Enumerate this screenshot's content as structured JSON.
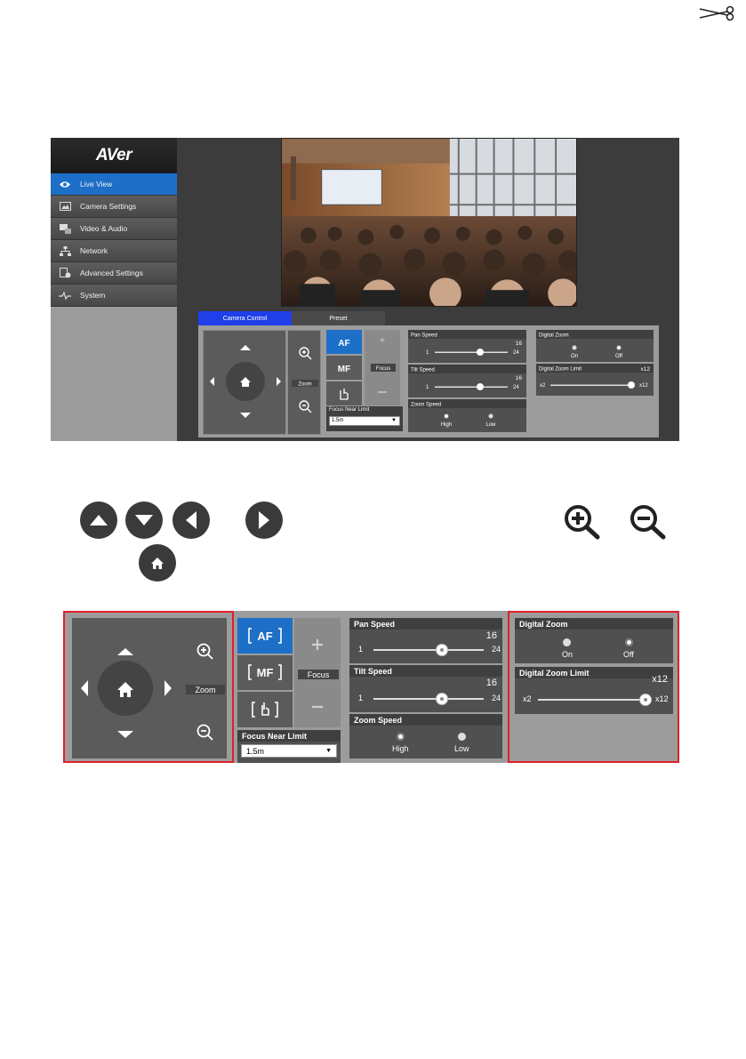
{
  "ui": {
    "logo": "AVer",
    "nav": [
      {
        "label": "Live View",
        "icon": "eye-icon",
        "active": true
      },
      {
        "label": "Camera Settings",
        "icon": "image-icon",
        "active": false
      },
      {
        "label": "Video & Audio",
        "icon": "video-audio-icon",
        "active": false
      },
      {
        "label": "Network",
        "icon": "network-icon",
        "active": false
      },
      {
        "label": "Advanced Settings",
        "icon": "settings-doc-icon",
        "active": false
      },
      {
        "label": "System",
        "icon": "pulse-icon",
        "active": false
      }
    ],
    "tabs": [
      "Camera Control",
      "Preset"
    ],
    "zoom_label": "Zoom",
    "focus_label": "Focus",
    "focus_buttons": [
      "AF",
      "MF"
    ],
    "focus_near_limit": {
      "label": "Focus Near Limit",
      "value": "1.5m"
    },
    "pan_speed": {
      "label": "Pan Speed",
      "value": "16",
      "min": "1",
      "max": "24",
      "level": 16
    },
    "tilt_speed": {
      "label": "Tilt Speed",
      "value": "16",
      "min": "1",
      "max": "24",
      "level": 16
    },
    "zoom_speed": {
      "label": "Zoom Speed",
      "options": [
        "High",
        "Low"
      ],
      "selected": "High"
    },
    "digital_zoom": {
      "label": "Digital Zoom",
      "options": [
        "On",
        "Off"
      ],
      "selected": "Off"
    },
    "digital_zoom_limit": {
      "label": "Digital Zoom Limit",
      "value": "x12",
      "min": "x2",
      "max": "x12",
      "level": 12
    }
  },
  "colors": {
    "accent_blue": "#1d6fc8",
    "tab_blue": "#1f3fe8",
    "highlight_red": "#e0202a",
    "panel_gray": "#9c9c9c",
    "tile_gray": "#5b5b5b"
  },
  "legend_icons": [
    "arrow-up-icon",
    "arrow-down-icon",
    "arrow-left-icon",
    "arrow-right-icon",
    "home-icon",
    "zoom-in-icon",
    "zoom-out-icon"
  ]
}
